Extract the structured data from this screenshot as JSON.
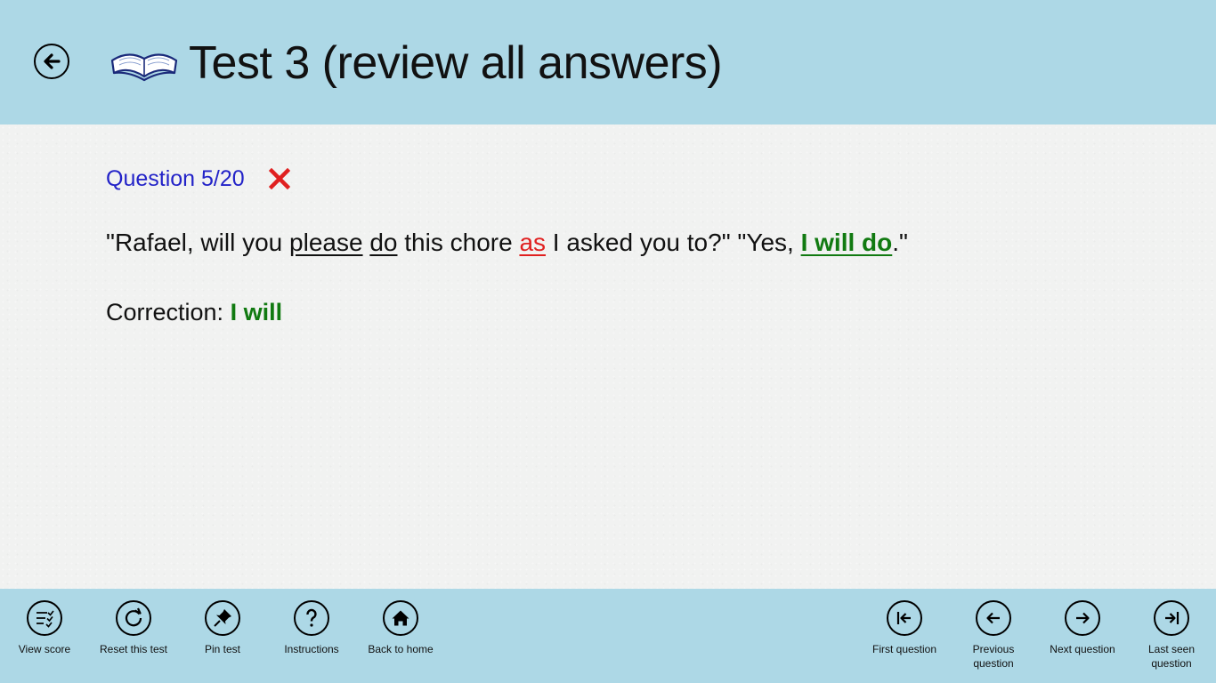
{
  "header": {
    "title": "Test 3 (review all answers)",
    "back_icon": "back-arrow-icon",
    "book_icon": "open-book-icon"
  },
  "question": {
    "label": "Question 5/20",
    "status": "incorrect",
    "status_icon": "red-x-icon",
    "sentence": {
      "p1": "\"Rafael, will you ",
      "please": "please",
      "sp1": " ",
      "do": "do",
      "p2": " this chore ",
      "as": "as",
      "p3": " I asked you to?\" \"Yes, ",
      "answer": "I will do",
      "p4": ".\""
    },
    "correction_label": "Correction: ",
    "correction_value": "I will"
  },
  "colors": {
    "header_bg": "#add8e6",
    "question_label": "#2323c8",
    "wrong": "#e02020",
    "correct": "#117a11"
  },
  "appbar": {
    "left": [
      {
        "label": "View score",
        "icon": "checklist-icon"
      },
      {
        "label": "Reset this test",
        "icon": "refresh-icon"
      },
      {
        "label": "Pin test",
        "icon": "pin-icon"
      },
      {
        "label": "Instructions",
        "icon": "question-mark-icon"
      },
      {
        "label": "Back to home",
        "icon": "home-icon"
      }
    ],
    "right": [
      {
        "label": "First question",
        "icon": "first-icon"
      },
      {
        "label_line1": "Previous",
        "label_line2": "question",
        "icon": "previous-icon"
      },
      {
        "label": "Next question",
        "icon": "next-icon"
      },
      {
        "label_line1": "Last seen",
        "label_line2": "question",
        "icon": "last-icon"
      }
    ]
  }
}
